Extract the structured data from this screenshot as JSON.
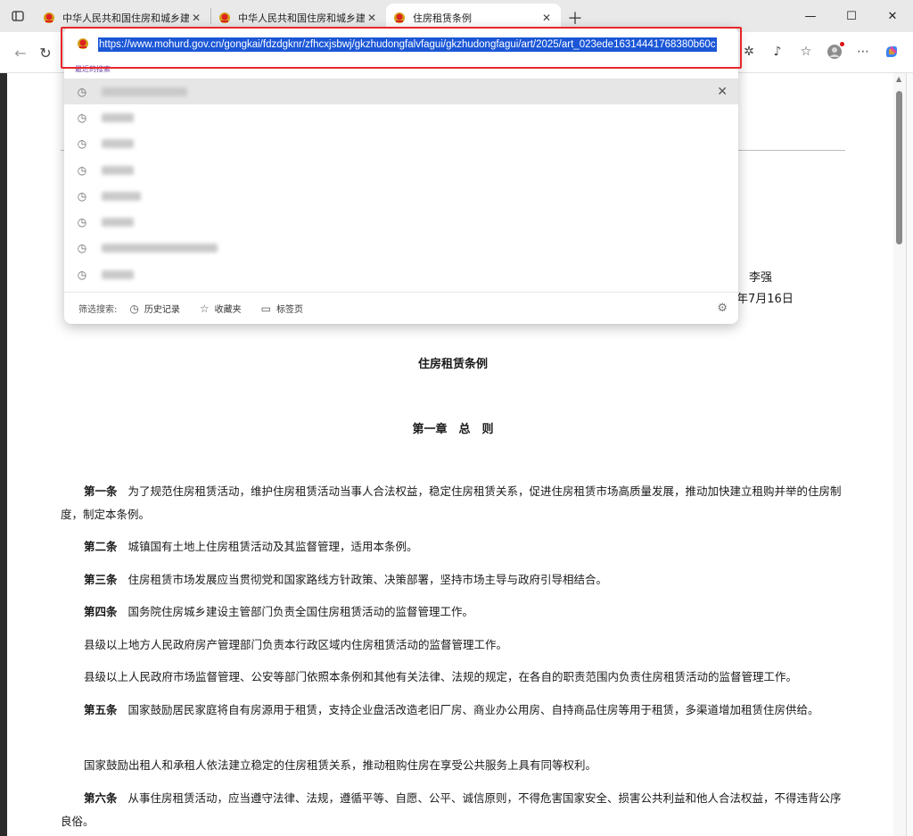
{
  "tabs": [
    {
      "title": "中华人民共和国住房和城乡建设部",
      "active": false
    },
    {
      "title": "中华人民共和国住房和城乡建设部",
      "active": false
    },
    {
      "title": "住房租赁条例",
      "active": true
    }
  ],
  "address_bar": {
    "url": "https://www.mohurd.gov.cn/gongkai/fdzdgknr/zfhcxjsbwj/gkzhudongfalvfagui/gkzhudongfagui/art/2025/art_023ede16314441768380b60c"
  },
  "omnibox": {
    "recent_label": "最近的搜索",
    "filter_label": "筛选搜索:",
    "filters": [
      "历史记录",
      "收藏夹",
      "标签页"
    ]
  },
  "document": {
    "signer": "李强",
    "date": "年7月16日",
    "title": "住房租赁条例",
    "chapter": "第一章　总　则",
    "articles": [
      {
        "label": "第一条",
        "text": "为了规范住房租赁活动，维护住房租赁活动当事人合法权益，稳定住房租赁关系，促进住房租赁市场高质量发展，推动加快建立租购并举的住房制度，制定本条例。"
      },
      {
        "label": "第二条",
        "text": "城镇国有土地上住房租赁活动及其监督管理，适用本条例。"
      },
      {
        "label": "第三条",
        "text": "住房租赁市场发展应当贯彻党和国家路线方针政策、决策部署，坚持市场主导与政府引导相结合。"
      },
      {
        "label": "第四条",
        "text": "国务院住房城乡建设主管部门负责全国住房租赁活动的监督管理工作。"
      },
      {
        "label": "",
        "text": "县级以上地方人民政府房产管理部门负责本行政区域内住房租赁活动的监督管理工作。"
      },
      {
        "label": "",
        "text": "县级以上人民政府市场监督管理、公安等部门依照本条例和其他有关法律、法规的规定，在各自的职责范围内负责住房租赁活动的监督管理工作。"
      },
      {
        "label": "第五条",
        "text": "国家鼓励居民家庭将自有房源用于租赁，支持企业盘活改造老旧厂房、商业办公用房、自持商品住房等用于租赁，多渠道增加租赁住房供给。"
      },
      {
        "label": "",
        "text": "国家鼓励出租人和承租人依法建立稳定的住房租赁关系，推动租购住房在享受公共服务上具有同等权利。"
      },
      {
        "label": "第六条",
        "text": "从事住房租赁活动，应当遵守法律、法规，遵循平等、自愿、公平、诚信原则，不得危害国家安全、损害公共利益和他人合法权益，不得违背公序良俗。"
      }
    ]
  }
}
